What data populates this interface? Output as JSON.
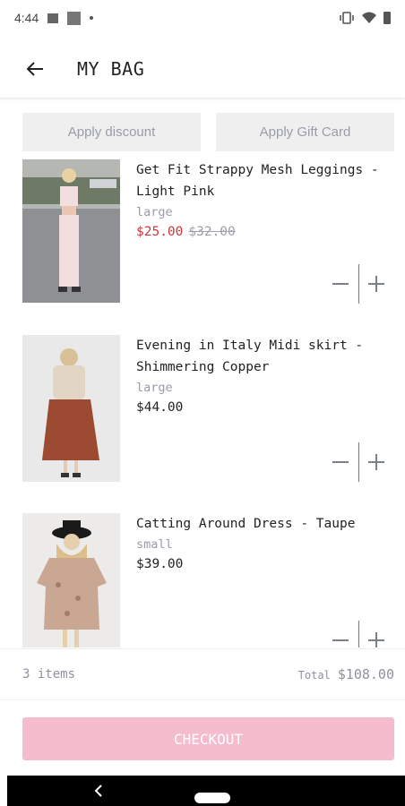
{
  "status_bar": {
    "time": "4:44"
  },
  "header": {
    "title": "MY BAG",
    "back_icon": "arrow-left-icon"
  },
  "actions": {
    "discount_label": "Apply discount",
    "gift_card_label": "Apply Gift Card"
  },
  "items": [
    {
      "name": "Get Fit Strappy Mesh Leggings - Light Pink",
      "variant": "large",
      "price": "$25.00",
      "original_price": "$32.00",
      "on_sale": true
    },
    {
      "name": "Evening in Italy Midi skirt - Shimmering Copper",
      "variant": "large",
      "price": "$44.00",
      "on_sale": false
    },
    {
      "name": "Catting Around Dress - Taupe",
      "variant": "small",
      "price": "$39.00",
      "on_sale": false
    }
  ],
  "summary": {
    "items_count": "3 items",
    "total_label": "Total",
    "total_value": "$108.00"
  },
  "checkout": {
    "label": "CHECKOUT"
  },
  "colors": {
    "sale_price": "#d0363b",
    "checkout_bg": "#f4bccd",
    "muted": "#9a9ca8",
    "button_bg": "#efeff0"
  }
}
